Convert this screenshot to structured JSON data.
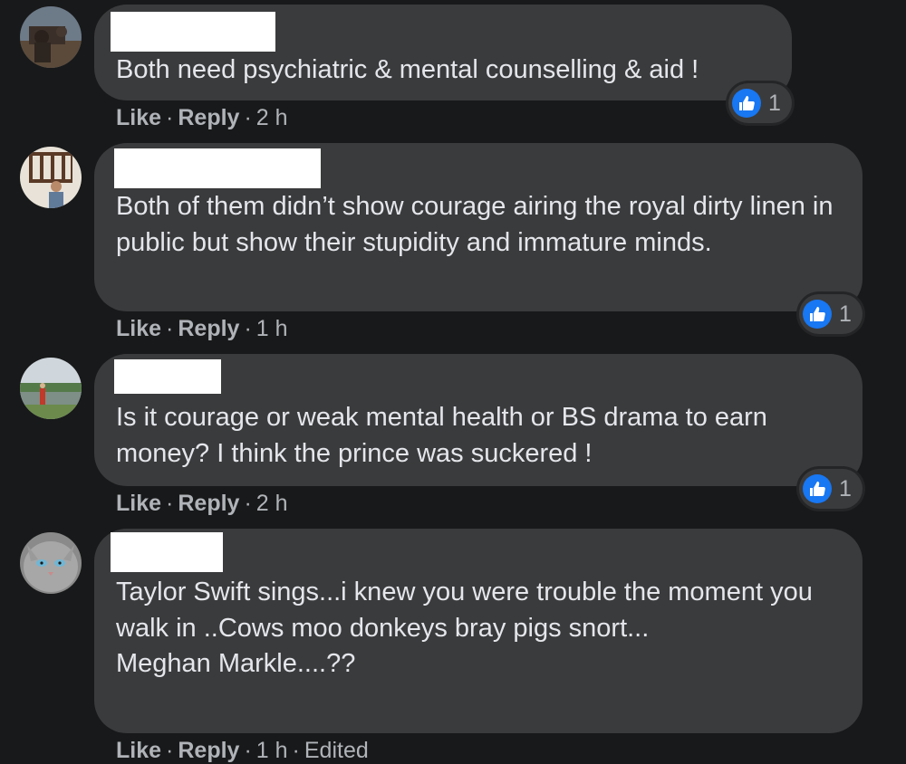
{
  "comments": [
    {
      "text": "Both need psychiatric & mental counselling & aid !",
      "like_label": "Like",
      "reply_label": "Reply",
      "time": "2 h",
      "reaction_count": "1",
      "reaction_icon": "like-icon"
    },
    {
      "text": "Both of them didn’t show courage airing the royal dirty linen in public but show their stupidity and immature minds.",
      "like_label": "Like",
      "reply_label": "Reply",
      "time": "1 h",
      "reaction_count": "1",
      "reaction_icon": "like-icon"
    },
    {
      "text": "Is it courage or weak mental health or BS drama to earn money? I think the prince was suckered !",
      "like_label": "Like",
      "reply_label": "Reply",
      "time": "2 h",
      "reaction_count": "1",
      "reaction_icon": "like-icon"
    },
    {
      "text": "Taylor Swift sings...i knew you were trouble the moment you walk in ..Cows moo donkeys bray pigs snort...\nMeghan Markle....??",
      "like_label": "Like",
      "reply_label": "Reply",
      "time": "1 h",
      "edited": "Edited"
    }
  ],
  "colors": {
    "background": "#18191a",
    "bubble": "#3a3b3c",
    "text": "#e4e6eb",
    "secondary_text": "#b0b3b8",
    "like_blue": "#1877f2",
    "redaction": "#ffffff"
  }
}
